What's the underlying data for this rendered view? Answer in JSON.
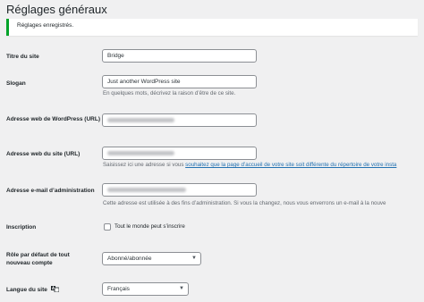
{
  "page": {
    "title": "Réglages généraux",
    "notice": "Réglages enregistrés."
  },
  "fields": {
    "site_title": {
      "label": "Titre du site",
      "value": "Bridge"
    },
    "tagline": {
      "label": "Slogan",
      "value": "Just another WordPress site",
      "description": "En quelques mots, décrivez la raison d’être de ce site."
    },
    "wp_address": {
      "label": "Adresse web de WordPress (URL)"
    },
    "site_address": {
      "label": "Adresse web du site (URL)",
      "desc_before": "Saisissez ici une adresse si vous ",
      "desc_link": "souhaitez que la page d’accueil de votre site soit différente du répertoire de votre insta"
    },
    "admin_email": {
      "label": "Adresse e-mail d’administration",
      "description": "Cette adresse est utilisée à des fins d’administration. Si vous la changez, nous vous enverrons un e-mail à la nouve"
    },
    "membership": {
      "label": "Inscription",
      "checkbox_label": "Tout le monde peut s’inscrire"
    },
    "default_role": {
      "label": "Rôle par défaut de tout nouveau compte",
      "value": "Abonné/abonnée"
    },
    "site_language": {
      "label": "Langue du site",
      "value": "Français",
      "icon": "translation-icon"
    }
  }
}
